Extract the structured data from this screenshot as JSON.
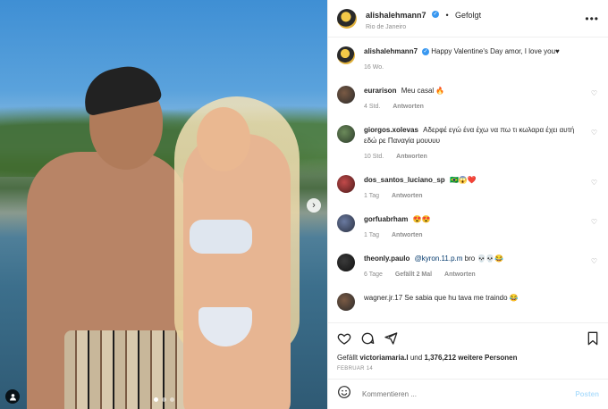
{
  "post": {
    "username": "alishalehmann7",
    "follow_status": "Gefolgt",
    "location": "Rio de Janeiro",
    "caption_text": "Happy Valentine's Day amor, I love you♥",
    "caption_age": "16 Wo."
  },
  "comments": [
    {
      "user": "eurarison",
      "text": "Meu casal 🔥",
      "age": "4 Std.",
      "reply": "Antworten",
      "likes": ""
    },
    {
      "user": "giorgos.xolevas",
      "text": "Αδερφέ εγώ ένα έχω να πω τι κωλαρα έχει αυτή εδώ ρε Παναγία μουυυυ",
      "age": "10 Std.",
      "reply": "Antworten",
      "likes": ""
    },
    {
      "user": "dos_santos_luciano_sp",
      "text": "🇧🇷😱❤️",
      "age": "1 Tag",
      "reply": "Antworten",
      "likes": ""
    },
    {
      "user": "gorfuabrham",
      "text": "😍😍",
      "age": "1 Tag",
      "reply": "Antworten",
      "likes": ""
    },
    {
      "user": "theonly.paulo",
      "mention": "@kyron.11.p.m",
      "text": "bro 💀💀😂",
      "age": "6 Tage",
      "likes": "Gefällt 2 Mal",
      "reply": "Antworten"
    }
  ],
  "partial_comment": "wagner.jr.17  Se sabia que hu tava me traindo 😂",
  "likes": {
    "prefix": "Gefällt",
    "liker": "victoriamaria.l",
    "middle": "und",
    "count": "1,376,212",
    "suffix": "weitere Personen"
  },
  "date": "FEBRUAR 14",
  "composer": {
    "placeholder": "Kommentieren ...",
    "post_label": "Posten"
  },
  "icons": {
    "like": "heart-icon",
    "comment": "comment-icon",
    "share": "paper-plane-icon",
    "save": "bookmark-icon",
    "emoji": "emoji-icon",
    "more": "more-icon",
    "next": "chevron-right-icon",
    "tag": "user-tag-icon"
  },
  "carousel": {
    "total": 3,
    "active": 1
  }
}
